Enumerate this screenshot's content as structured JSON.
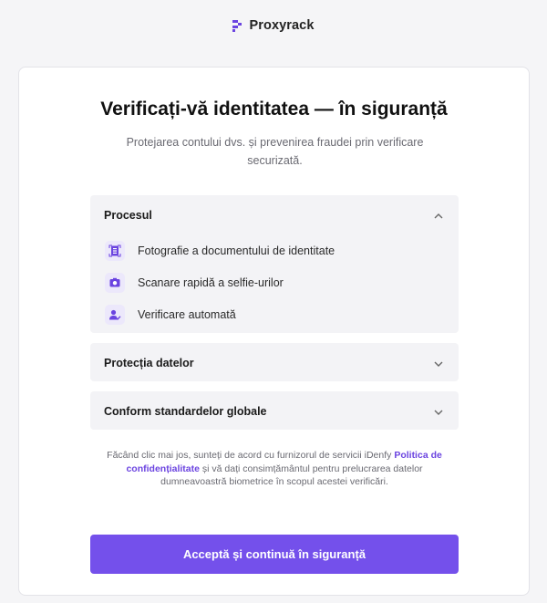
{
  "brand": {
    "name": "Proxyrack",
    "accent": "#7450eb"
  },
  "card": {
    "title": "Verificați-vă identitatea — în siguranță",
    "subtitle": "Protejarea contului dvs. și prevenirea fraudei prin verificare securizată."
  },
  "accordions": [
    {
      "title": "Procesul",
      "expanded": true,
      "chevron": "chevron-up-icon",
      "items": [
        {
          "icon": "id-document-icon",
          "label": "Fotografie a documentului de identitate"
        },
        {
          "icon": "camera-icon",
          "label": "Scanare rapidă a selfie-urilor"
        },
        {
          "icon": "user-check-icon",
          "label": "Verificare automată"
        }
      ]
    },
    {
      "title": "Protecția datelor",
      "expanded": false,
      "chevron": "chevron-down-icon"
    },
    {
      "title": "Conform standardelor globale",
      "expanded": false,
      "chevron": "chevron-down-icon"
    }
  ],
  "consent": {
    "before": "Făcând clic mai jos, sunteți de acord cu furnizorul de servicii iDenfy ",
    "link": "Politica de confidențialitate",
    "after": " și vă dați consimțământul pentru prelucrarea datelor dumneavoastră biometrice în scopul acestei verificări."
  },
  "cta": {
    "label": "Acceptă și continuă în siguranță"
  }
}
